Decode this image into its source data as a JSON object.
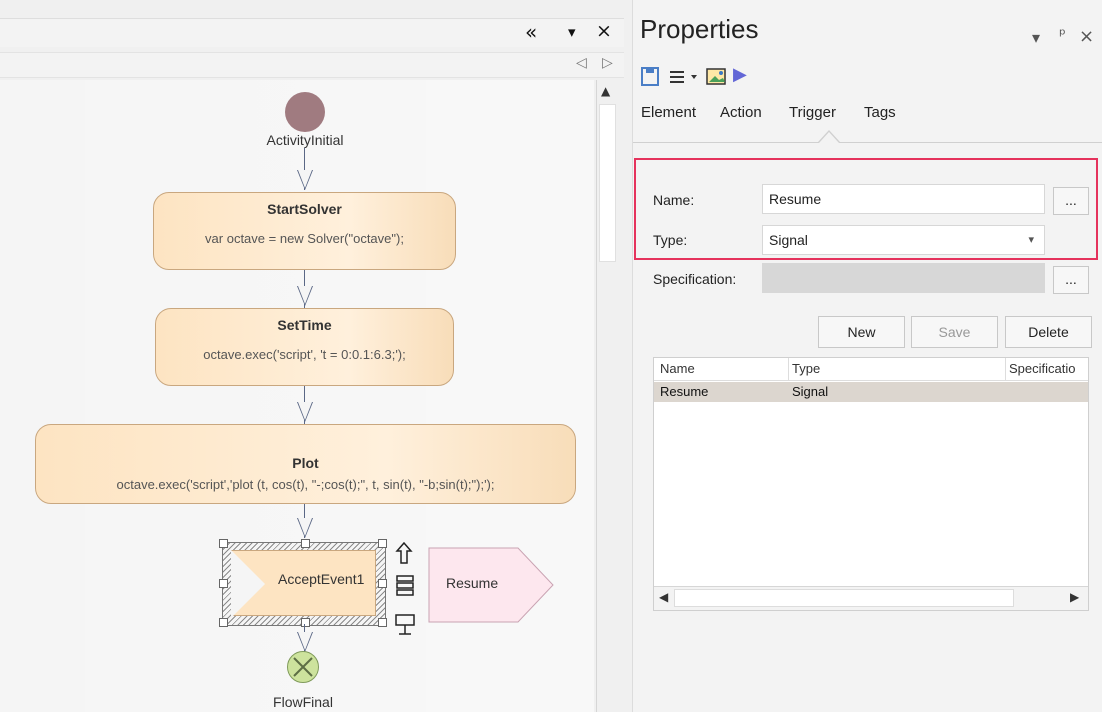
{
  "left_panel": {
    "header_controls": {
      "collapse": "«",
      "menu": "▾",
      "close": "×"
    },
    "subheader_controls": {
      "left": "◁",
      "right": "▷"
    },
    "scroll_up": "▲"
  },
  "diagram": {
    "activity_initial_label": "ActivityInitial",
    "start_solver": {
      "title": "StartSolver",
      "code": "var octave = new Solver(\"octave\");"
    },
    "set_time": {
      "title": "SetTime",
      "code": "octave.exec('script', 't = 0:0.1:6.3;');"
    },
    "plot": {
      "title": "Plot",
      "code": "octave.exec('script','plot (t, cos(t), \"-;cos(t);\", t, sin(t), \"-b;sin(t);\");');"
    },
    "accept_event": {
      "label": "AcceptEvent1"
    },
    "resume_signal": {
      "label": "Resume"
    },
    "flow_final_label": "FlowFinal"
  },
  "properties": {
    "title": "Properties",
    "window_controls": {
      "menu": "▾",
      "pin": "ᵖ",
      "close": "×"
    },
    "toolbar": {
      "play": "▶"
    },
    "tabs": [
      "Element",
      "Action",
      "Trigger",
      "Tags"
    ],
    "active_tab": "Trigger",
    "name_label": "Name:",
    "name_value": "Resume",
    "type_label": "Type:",
    "type_value": "Signal",
    "specification_label": "Specification:",
    "ellipsis": "...",
    "buttons": {
      "new": "New",
      "save": "Save",
      "delete": "Delete"
    },
    "table": {
      "headers": [
        "Name",
        "Type",
        "Specificatio"
      ],
      "rows": [
        {
          "name": "Resume",
          "type": "Signal",
          "specification": ""
        }
      ]
    }
  },
  "colors": {
    "highlight_border": "#e5325c",
    "activity_fill": "#fde4c2",
    "activity_border": "#c9a77f",
    "signal_fill": "#fde7ee",
    "initial_node": "#a07b80",
    "final_node": "#cde39d",
    "accent_play": "#6266d6"
  }
}
